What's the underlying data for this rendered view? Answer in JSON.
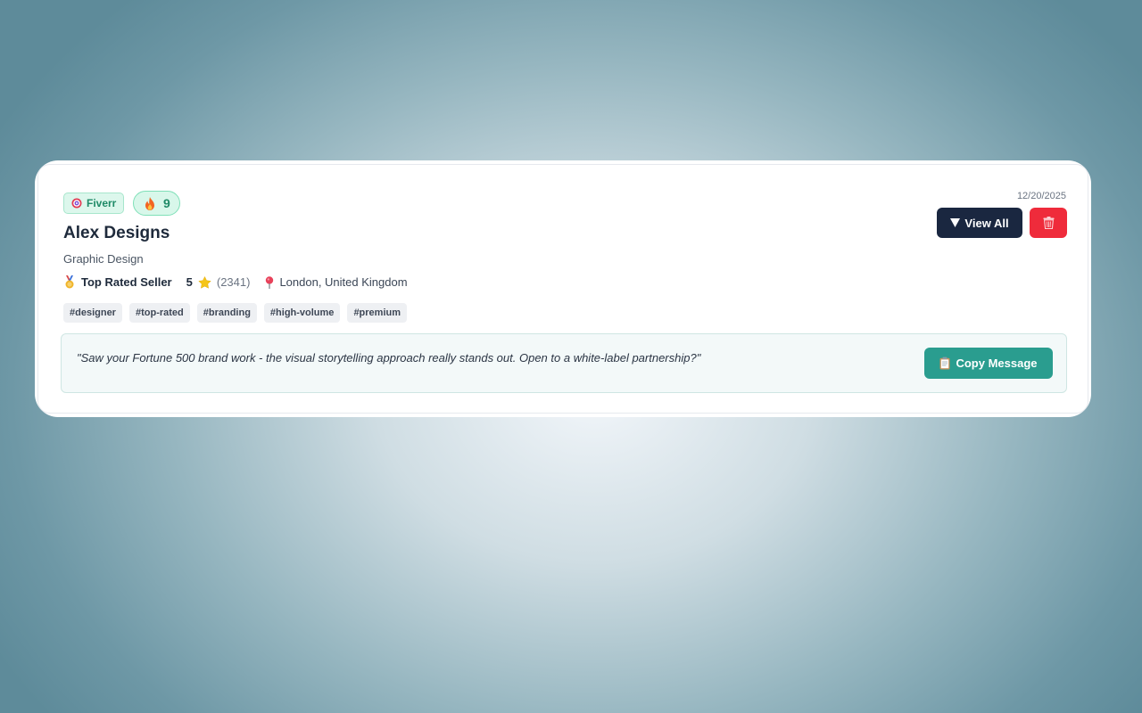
{
  "lead": {
    "platform": "Fiverr",
    "score": "9",
    "name": "Alex Designs",
    "category": "Graphic Design",
    "seller_level": "Top Rated Seller",
    "rating": "5",
    "reviews": "(2341)",
    "location": "London, United Kingdom",
    "date": "12/20/2025",
    "tags": [
      "#designer",
      "#top-rated",
      "#branding",
      "#high-volume",
      "#premium"
    ],
    "message": "\"Saw your Fortune 500 brand work - the visual storytelling approach really stands out. Open to a white-label partnership?\""
  },
  "actions": {
    "view_all_label": "View All",
    "copy_label": "Copy Message"
  },
  "icons": {
    "platform": "target-icon",
    "score": "fire-icon",
    "seller_level": "medal-icon",
    "rating": "star-icon",
    "location": "pin-icon",
    "view_all": "triangle-down-icon",
    "delete": "trash-icon",
    "copy": "clipboard-icon"
  },
  "colors": {
    "primary_dark": "#1a2740",
    "danger": "#ef2b3b",
    "accent_teal": "#2a9d8f",
    "badge_green": "#1f8a67"
  }
}
